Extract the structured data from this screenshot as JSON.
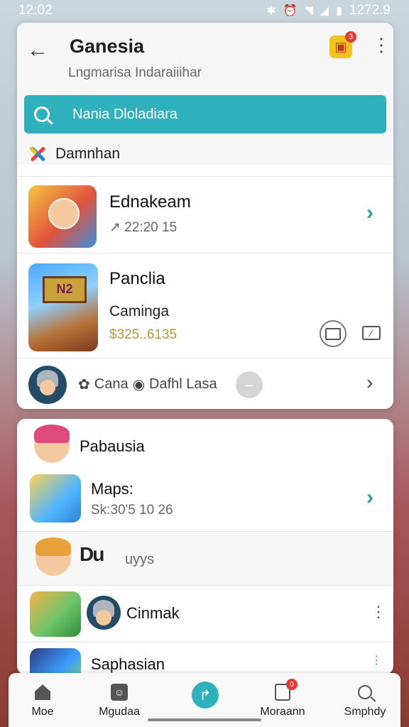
{
  "status_bar": {
    "time": "12:02",
    "clock_right": "1272.9"
  },
  "header": {
    "title": "Ganesia",
    "subtitle": "Lngmarisa Indaraiiihar",
    "notification_badge": "3"
  },
  "search": {
    "text": "Nania Dloladiara"
  },
  "section": {
    "label": "Damnhan"
  },
  "list1": [
    {
      "name": "Ednakeam",
      "meta": "↗ 22:20 15"
    },
    {
      "name": "Panclia",
      "sub": "Caminga",
      "price": "$325..6135"
    }
  ],
  "footer_row": {
    "chip1": "Cana",
    "chip2": "Dafhl Lasa"
  },
  "card2": {
    "section_label": "Pabausia",
    "items": [
      {
        "name": "Maps:",
        "meta": "Sk:30'5 10 26"
      },
      {
        "brand": "Du",
        "brand_suffix": "uyys"
      },
      {
        "name": "Cinmak"
      },
      {
        "name": "Saphasian"
      }
    ]
  },
  "bottom_nav": {
    "items": [
      {
        "label": "Moe",
        "icon": "home-icon"
      },
      {
        "label": "Mgudaa",
        "icon": "box-icon"
      },
      {
        "label": "",
        "icon": "share-icon"
      },
      {
        "label": "Moraann",
        "icon": "tab-icon",
        "badge": "0"
      },
      {
        "label": "Smphdy",
        "icon": "search-icon"
      }
    ]
  },
  "colors": {
    "accent": "#2fb1bd",
    "badge": "#e53935",
    "price": "#b9963a"
  }
}
